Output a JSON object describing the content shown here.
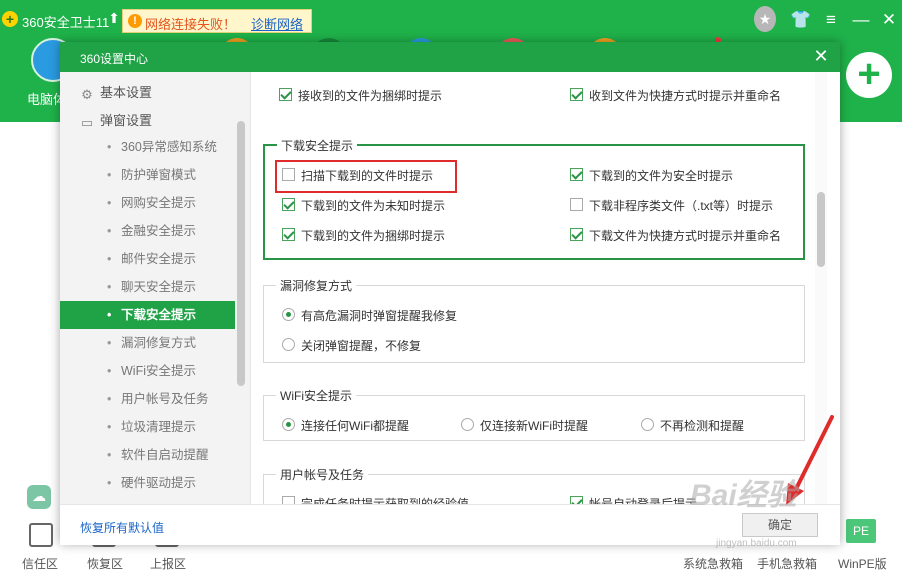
{
  "app": {
    "title": "360安全卫士11",
    "net_alert": {
      "icon": "warning-icon",
      "message": "网络连接失败！",
      "link": "诊断网络"
    },
    "left_tool_label": "电脑体"
  },
  "bottom_bar": {
    "left_items": [
      "信任区",
      "恢复区",
      "上报区"
    ],
    "right_items": [
      "系统急救箱",
      "手机急救箱",
      "WinPE版"
    ],
    "pe_badge": "PE"
  },
  "dialog": {
    "title": "360设置中心",
    "close_icon": "close-icon",
    "sidebar": {
      "groups": [
        {
          "icon": "gear-icon",
          "label": "基本设置"
        },
        {
          "icon": "window-icon",
          "label": "弹窗设置"
        }
      ],
      "items": [
        "360异常感知系统",
        "防护弹窗模式",
        "网购安全提示",
        "金融安全提示",
        "邮件安全提示",
        "聊天安全提示",
        "下载安全提示",
        "漏洞修复方式",
        "WiFi安全提示",
        "用户帐号及任务",
        "垃圾清理提示",
        "软件自启动提醒",
        "硬件驱动提示"
      ],
      "active_item": "下载安全提示"
    },
    "content": {
      "top_row": {
        "left": {
          "label": "接收到的文件为捆绑时提示",
          "checked": true
        },
        "right": {
          "label": "收到文件为快捷方式时提示并重命名",
          "checked": true
        }
      },
      "download_section": {
        "legend": "下载安全提示",
        "options": [
          {
            "label": "扫描下载到的文件时提示",
            "checked": false
          },
          {
            "label": "下载到的文件为安全时提示",
            "checked": true
          },
          {
            "label": "下载到的文件为未知时提示",
            "checked": true
          },
          {
            "label": "下载非程序类文件（.txt等）时提示",
            "checked": false
          },
          {
            "label": "下载到的文件为捆绑时提示",
            "checked": true
          },
          {
            "label": "下载文件为快捷方式时提示并重命名",
            "checked": true
          }
        ]
      },
      "vuln_section": {
        "legend": "漏洞修复方式",
        "options": [
          {
            "label": "有高危漏洞时弹窗提醒我修复",
            "selected": true
          },
          {
            "label": "关闭弹窗提醒，不修复",
            "selected": false
          }
        ]
      },
      "wifi_section": {
        "legend": "WiFi安全提示",
        "options": [
          {
            "label": "连接任何WiFi都提醒",
            "selected": true
          },
          {
            "label": "仅连接新WiFi时提醒",
            "selected": false
          },
          {
            "label": "不再检测和提醒",
            "selected": false
          }
        ]
      },
      "account_section": {
        "legend": "用户帐号及任务",
        "options": [
          {
            "label": "完成任务时提示获取到的经验值",
            "checked": false
          },
          {
            "label": "帐号自动登录后提示",
            "checked": true
          }
        ]
      }
    },
    "footer": {
      "restore_link": "恢复所有默认值",
      "ok_button": "确定"
    }
  },
  "watermark": {
    "text": "Bai经验",
    "sub": "jingyan.baidu.com"
  },
  "colors": {
    "brand_green": "#1fb24a",
    "dialog_green": "#1fa346",
    "highlight_red": "#e02b2b",
    "link_blue": "#1a64c8"
  }
}
